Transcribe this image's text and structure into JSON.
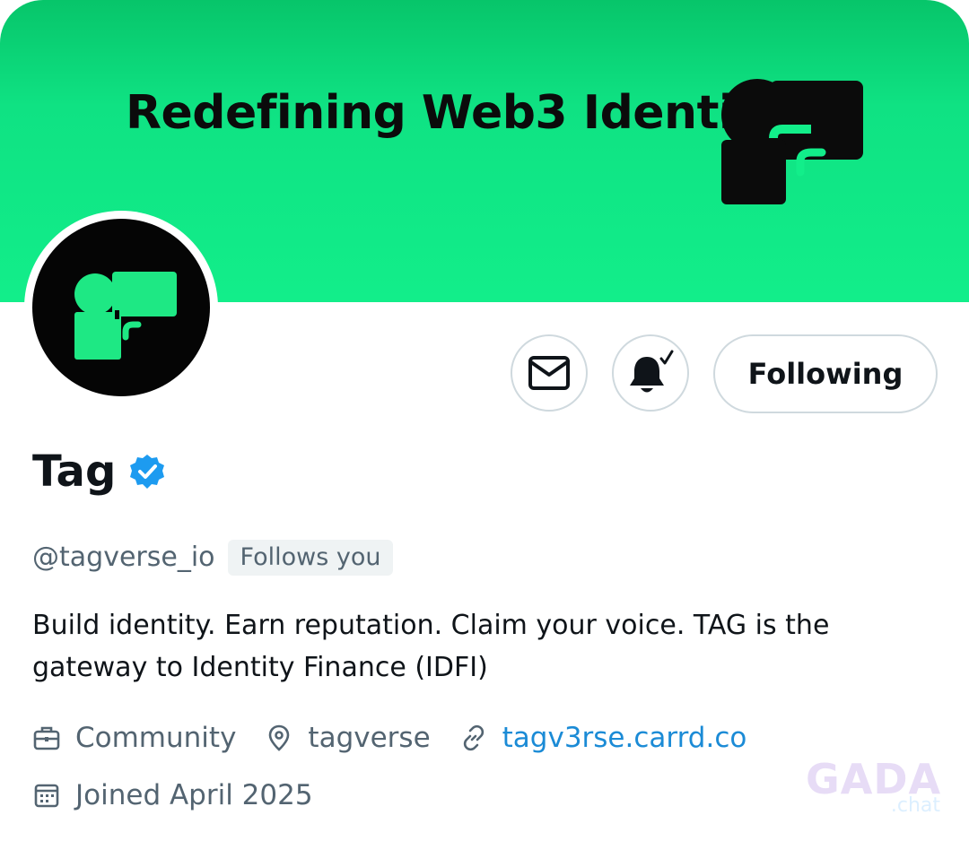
{
  "banner": {
    "headline": "Redefining Web3 Identity",
    "color": "#12ee8a"
  },
  "profile": {
    "display_name": "Tag",
    "verified": true,
    "handle": "@tagverse_io",
    "follows_you_label": "Follows you",
    "bio": "Build identity. Earn reputation. Claim your voice. TAG is the gateway to Identity Finance (IDFI)"
  },
  "actions": {
    "message_icon": "mail-icon",
    "notifications_icon": "bell-check-icon",
    "follow_label": "Following"
  },
  "meta": {
    "category": {
      "icon": "briefcase-icon",
      "label": "Community"
    },
    "location": {
      "icon": "location-pin-icon",
      "label": "tagverse"
    },
    "website": {
      "icon": "link-icon",
      "label": "tagv3rse.carrd.co"
    },
    "joined": {
      "icon": "calendar-icon",
      "label": "Joined April 2025"
    }
  },
  "watermark": {
    "main": "GADA",
    "sub": ".chat"
  },
  "colors": {
    "accent_link": "#1b8bd6",
    "verified_badge": "#1d9bf0",
    "secondary_text": "#536471",
    "primary_text": "#0f1419"
  }
}
